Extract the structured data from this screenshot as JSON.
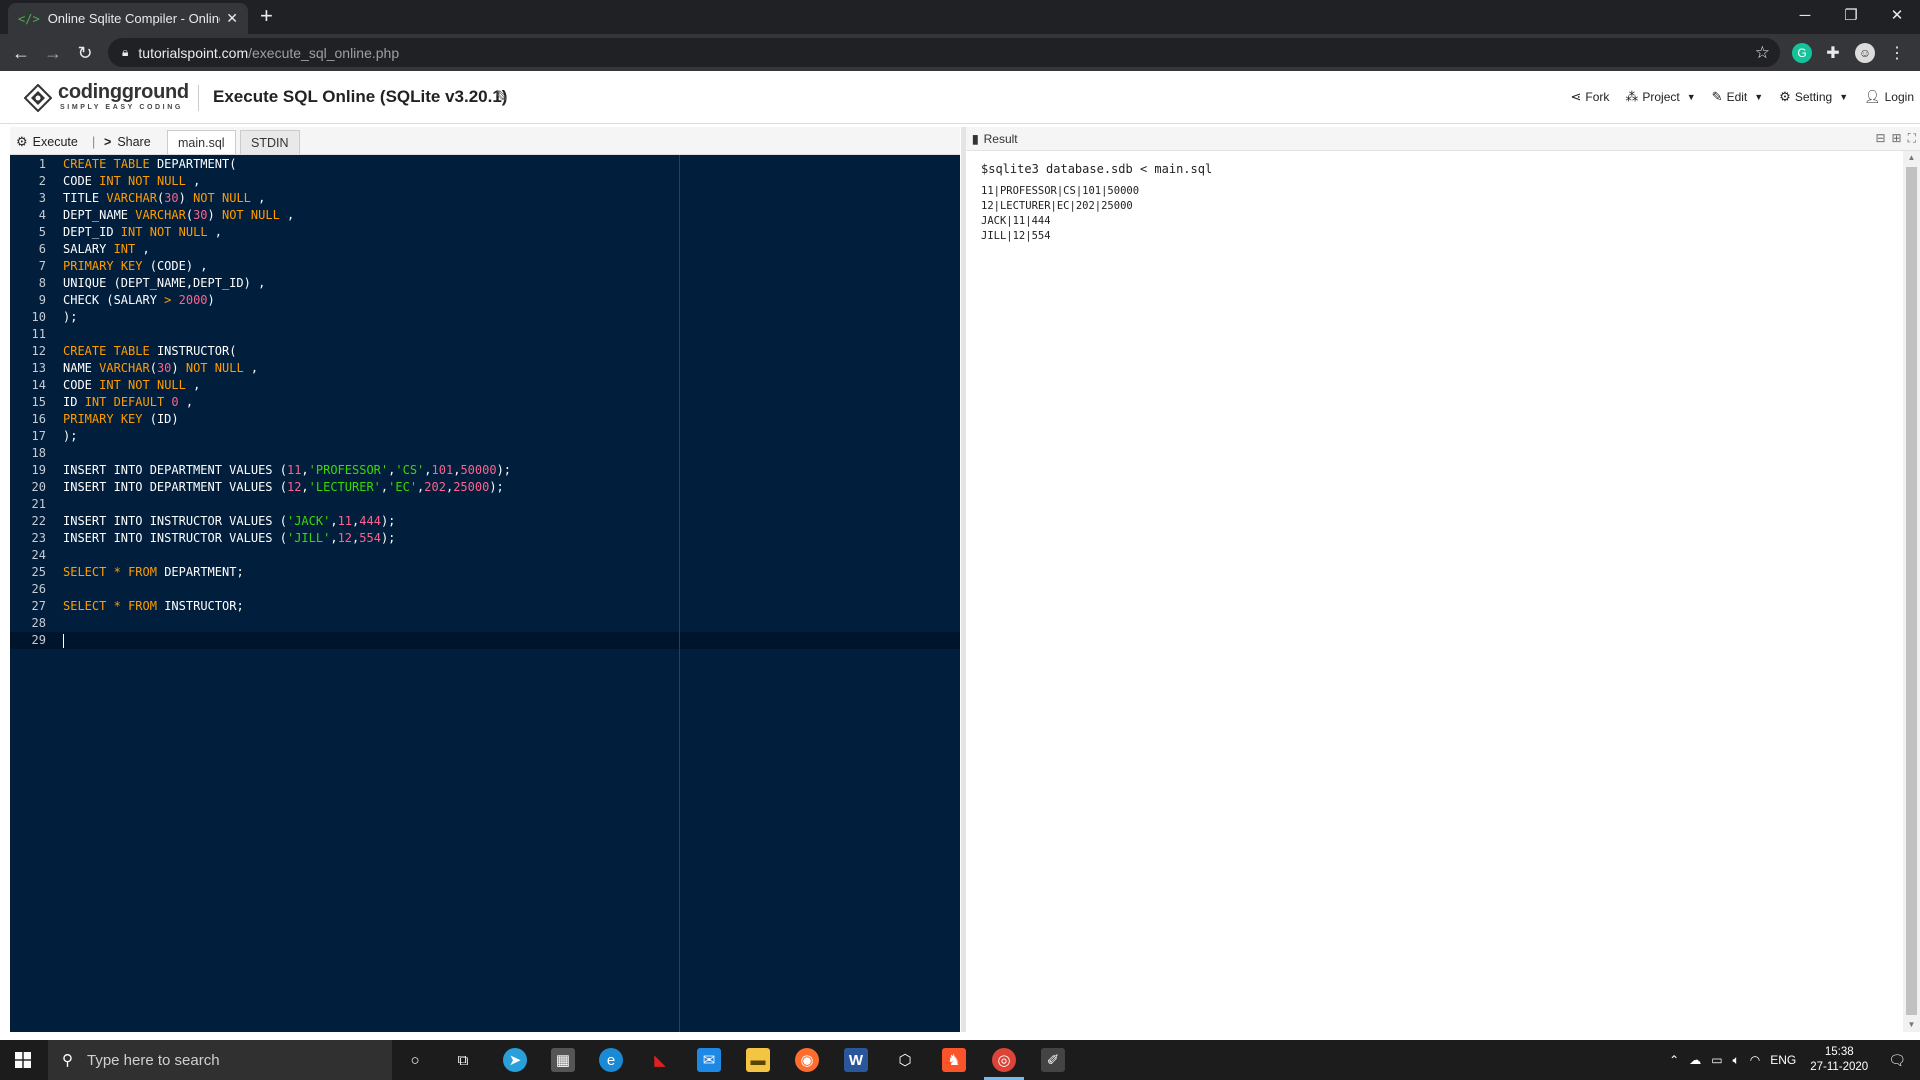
{
  "browser": {
    "tab_title": "Online Sqlite Compiler - Online S",
    "favicon_text": "</>",
    "new_tab": "+",
    "close_tab": "✕",
    "url_host": "tutorialspoint.com",
    "url_path": "/execute_sql_online.php",
    "window_controls": {
      "minimize": "─",
      "restore": "❐",
      "close": "✕"
    }
  },
  "site": {
    "logo_text": "codingground",
    "logo_tagline": "SIMPLY EASY CODING",
    "page_title": "Execute SQL Online (SQLite v3.20.1)",
    "menu": {
      "fork": "Fork",
      "project": "Project",
      "edit": "Edit",
      "setting": "Setting",
      "login": "Login"
    }
  },
  "editor": {
    "execute_label": "Execute",
    "share_label": "Share",
    "tab_file": "main.sql",
    "tab_stdin": "STDIN",
    "code_lines": [
      "CREATE TABLE DEPARTMENT(",
      "CODE INT NOT NULL ,",
      "TITLE VARCHAR(30) NOT NULL ,",
      "DEPT_NAME VARCHAR(30) NOT NULL ,",
      "DEPT_ID INT NOT NULL ,",
      "SALARY INT ,",
      "PRIMARY KEY (CODE) ,",
      "UNIQUE (DEPT_NAME,DEPT_ID) ,",
      "CHECK (SALARY > 2000)",
      ");",
      "",
      "CREATE TABLE INSTRUCTOR(",
      "NAME VARCHAR(30) NOT NULL ,",
      "CODE INT NOT NULL ,",
      "ID INT DEFAULT 0 ,",
      "PRIMARY KEY (ID)",
      ");",
      "",
      "INSERT INTO DEPARTMENT VALUES (11,'PROFESSOR','CS',101,50000);",
      "INSERT INTO DEPARTMENT VALUES (12,'LECTURER','EC',202,25000);",
      "",
      "INSERT INTO INSTRUCTOR VALUES ('JACK',11,444);",
      "INSERT INTO INSTRUCTOR VALUES ('JILL',12,554);",
      "",
      "SELECT * FROM DEPARTMENT;",
      "",
      "SELECT * FROM INSTRUCTOR;",
      "",
      ""
    ],
    "active_line": 29
  },
  "result": {
    "title": "Result",
    "command": "$sqlite3 database.sdb < main.sql",
    "output_lines": [
      "11|PROFESSOR|CS|101|50000",
      "12|LECTURER|EC|202|25000",
      "JACK|11|444",
      "JILL|12|554"
    ]
  },
  "taskbar": {
    "search_placeholder": "Type here to search",
    "language": "ENG",
    "time": "15:38",
    "date": "27-11-2020"
  },
  "colors": {
    "editor_bg": "#011e3c",
    "keyword": "#ff9d00",
    "number": "#ff628c",
    "string": "#3ad900"
  }
}
